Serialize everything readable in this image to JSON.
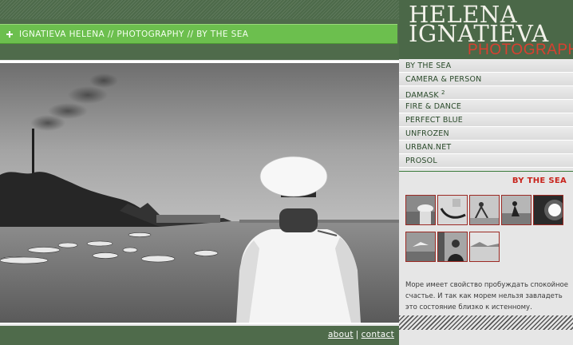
{
  "header": {
    "breadcrumb": "IGNATIEVA HELENA // PHOTOGRAPHY // BY THE SEA",
    "brand_line1": "HELENA",
    "brand_line2": "IGNATIEVA",
    "brand_sub": "PHOTOGRAPHER"
  },
  "menu": {
    "items": [
      {
        "label": "BY THE SEA"
      },
      {
        "label": "CAMERA & PERSON"
      },
      {
        "label": "DAMASK",
        "sup": "2"
      },
      {
        "label": "FIRE & DANCE"
      },
      {
        "label": "PERFECT BLUE"
      },
      {
        "label": "UNFROZEN"
      },
      {
        "label": "URBAN.NET"
      },
      {
        "label": "PROSOL"
      }
    ]
  },
  "gallery": {
    "title": "BY THE SEA",
    "description": "Море имеет свойство пробуждать спокойное счастье. И так как морем нельзя завладеть это состояние близко к истенному.",
    "thumbnail_count": 8
  },
  "footer": {
    "about": "about",
    "separator": "|",
    "contact": "contact"
  },
  "colors": {
    "header_green": "#4f6b4b",
    "breadcrumb_green": "#6cbf4e",
    "accent_red": "#c8241c"
  }
}
